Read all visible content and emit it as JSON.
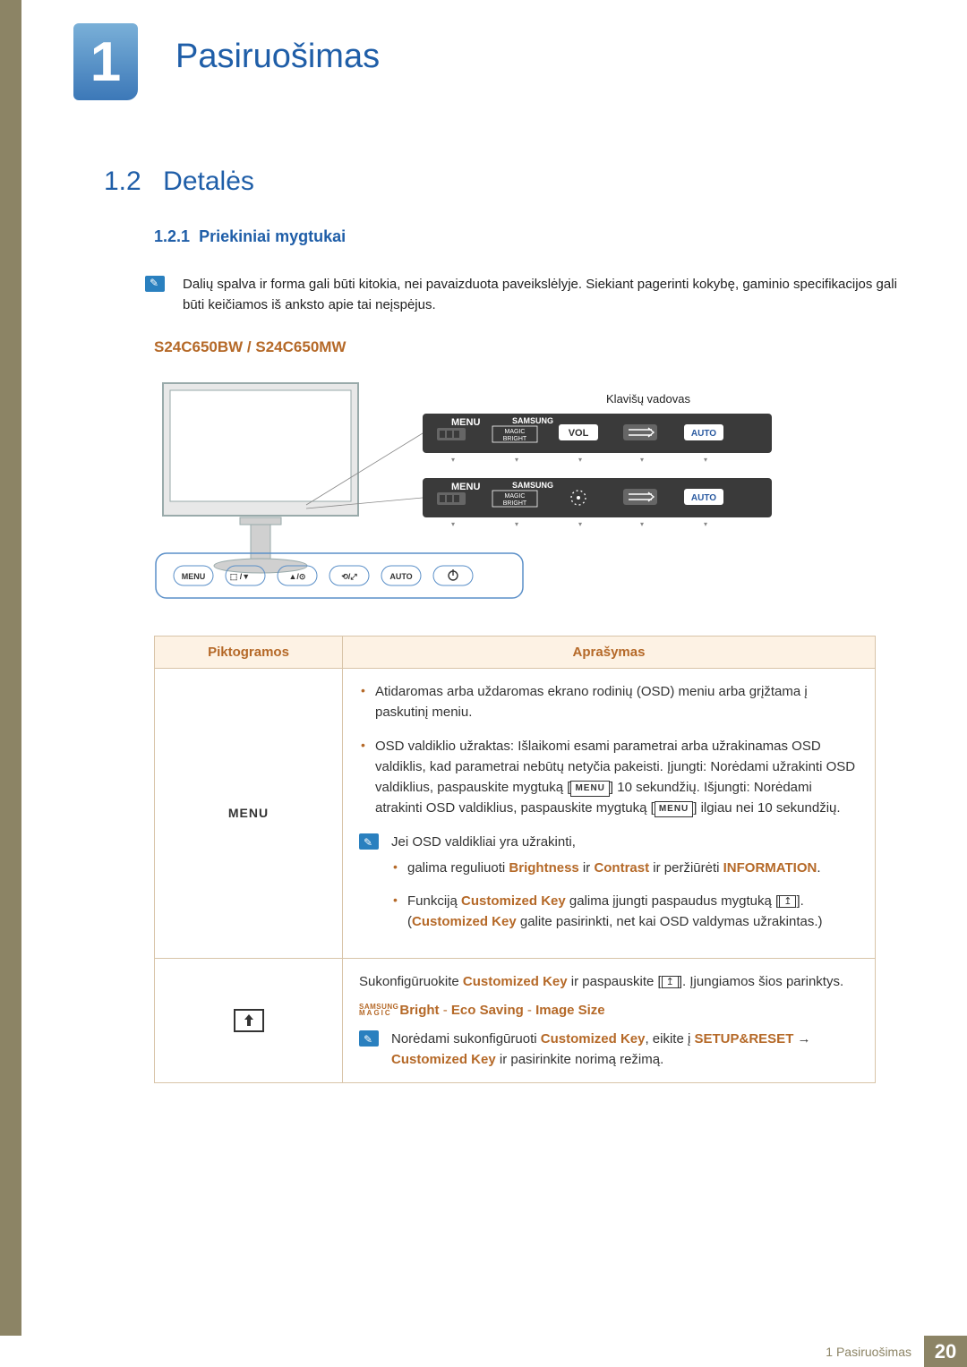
{
  "chapter": {
    "number": "1",
    "title": "Pasiruošimas"
  },
  "section": {
    "number": "1.2",
    "title": "Detalės"
  },
  "subsection": {
    "number": "1.2.1",
    "title": "Priekiniai mygtukai"
  },
  "note": "Dalių spalva ir forma gali būti kitokia, nei pavaizduota paveikslėlyje. Siekiant pagerinti kokybę, gaminio specifikacijos gali būti keičiamos iš anksto apie tai neįspėjus.",
  "model": "S24C650BW / S24C650MW",
  "diagram": {
    "key_guide_label": "Klavišų vadovas",
    "pill_buttons": [
      "MENU",
      "",
      "",
      "",
      "AUTO",
      ""
    ],
    "key_row1": {
      "col1": "MENU",
      "brand": "SAMSUNG",
      "magic": "MAGIC",
      "bright": "BRIGHT",
      "vol": "VOL",
      "auto": "AUTO"
    },
    "key_row2": {
      "col1": "MENU",
      "brand": "SAMSUNG",
      "magic": "MAGIC",
      "bright": "BRIGHT",
      "auto": "AUTO"
    }
  },
  "table": {
    "headers": {
      "icons": "Piktogramos",
      "desc": "Aprašymas"
    },
    "row1": {
      "icon_label": "MENU",
      "b1": "Atidaromas arba uždaromas ekrano rodinių (OSD) meniu arba grįžtama į paskutinį meniu.",
      "b2a": "OSD valdiklio užraktas: Išlaikomi esami parametrai arba užrakinamas OSD valdiklis, kad parametrai nebūtų netyčia pakeisti. Įjungti: Norėdami užrakinti OSD valdiklius, paspauskite mygtuką [",
      "b2b": "] 10 sekundžių. Išjungti: Norėdami atrakinti OSD valdiklius, paspauskite mygtuką [",
      "b2c": "] ilgiau nei 10 sekundžių.",
      "menu_tag": "MENU",
      "subnote": "Jei OSD valdikliai yra užrakinti,",
      "s1a": "galima reguliuoti ",
      "s1_brightness": "Brightness",
      "s1_ir1": " ir ",
      "s1_contrast": "Contrast",
      "s1_ir2": " ir peržiūrėti ",
      "s1_info": "INFORMATION",
      "s1_dot": ".",
      "s2a": "Funkciją ",
      "s2_ck": "Customized Key",
      "s2b": " galima įjungti paspaudus mygtuką [",
      "s2c": "]. (",
      "s2_ck2": "Customized Key",
      "s2d": " galite pasirinkti, net kai OSD valdymas užrakintas.)"
    },
    "row2": {
      "p1a": "Sukonfigūruokite ",
      "p1_ck": "Customized Key",
      "p1b": " ir paspauskite [",
      "p1c": "]. Įjungiamos šios parinktys.",
      "magic_top": "SAMSUNG",
      "magic_bot": "MAGIC",
      "opt_bright": "Bright",
      "sep": " - ",
      "opt_eco": "Eco Saving",
      "opt_size": "Image Size",
      "sub_a": "Norėdami sukonfigūruoti ",
      "sub_ck": "Customized Key",
      "sub_b": ", eikite į ",
      "sub_setup": "SETUP&RESET",
      "sub_c": " → ",
      "sub_ck2": "Customized Key",
      "sub_d": " ir pasirinkite norimą režimą."
    }
  },
  "footer": {
    "text": "1 Pasiruošimas",
    "page": "20"
  }
}
